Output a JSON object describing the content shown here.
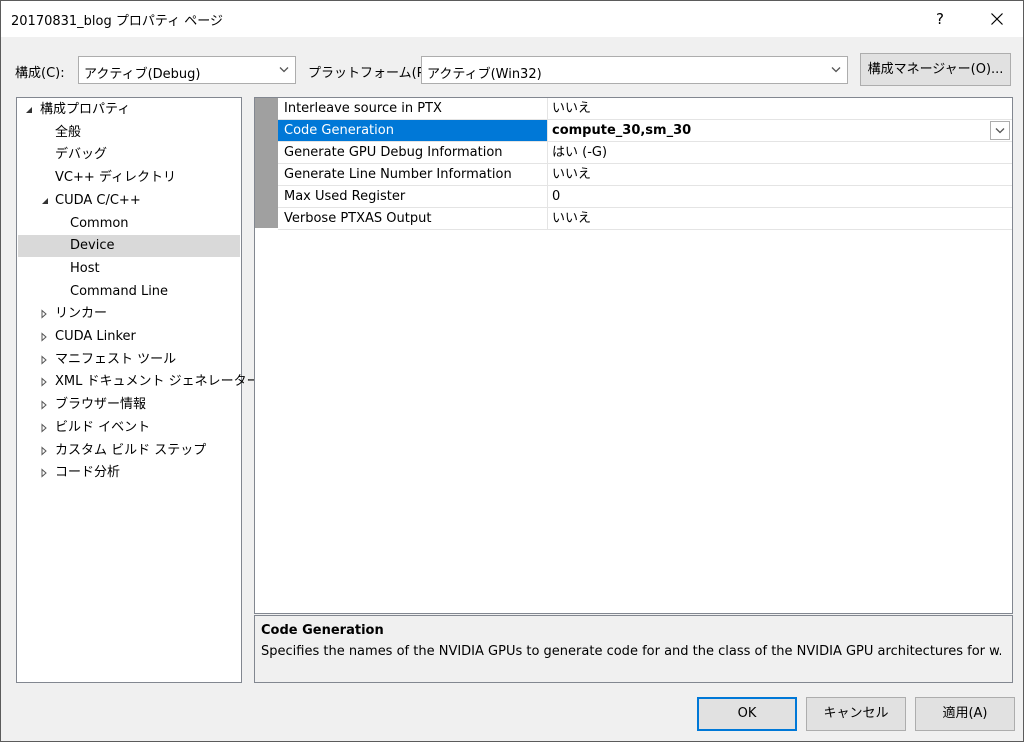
{
  "window": {
    "title": "20170831_blog プロパティ ページ",
    "help_label": "?"
  },
  "config": {
    "label": "構成(C):",
    "value": "アクティブ(Debug)"
  },
  "platform": {
    "label": "プラットフォーム(P):",
    "value": "アクティブ(Win32)"
  },
  "config_manager_label": "構成マネージャー(O)...",
  "tree": [
    {
      "label": "構成プロパティ",
      "expander": "expanded"
    },
    {
      "label": "全般",
      "expander": "none"
    },
    {
      "label": "デバッグ",
      "expander": "none"
    },
    {
      "label": "VC++ ディレクトリ",
      "expander": "none"
    },
    {
      "label": "CUDA C/C++",
      "expander": "expanded"
    },
    {
      "label": "Common",
      "expander": "none"
    },
    {
      "label": "Device",
      "expander": "none",
      "selected": true
    },
    {
      "label": "Host",
      "expander": "none"
    },
    {
      "label": "Command Line",
      "expander": "none"
    },
    {
      "label": "リンカー",
      "expander": "collapsed"
    },
    {
      "label": "CUDA Linker",
      "expander": "collapsed"
    },
    {
      "label": "マニフェスト ツール",
      "expander": "collapsed"
    },
    {
      "label": "XML ドキュメント ジェネレーター",
      "expander": "collapsed"
    },
    {
      "label": "ブラウザー情報",
      "expander": "collapsed"
    },
    {
      "label": "ビルド イベント",
      "expander": "collapsed"
    },
    {
      "label": "カスタム ビルド ステップ",
      "expander": "collapsed"
    },
    {
      "label": "コード分析",
      "expander": "collapsed"
    }
  ],
  "properties": [
    {
      "name": "Interleave source in PTX",
      "value": "いいえ"
    },
    {
      "name": "Code Generation",
      "value": "compute_30,sm_30",
      "selected": true
    },
    {
      "name": "Generate GPU Debug Information",
      "value": "はい (-G)"
    },
    {
      "name": "Generate Line Number Information",
      "value": "いいえ"
    },
    {
      "name": "Max Used Register",
      "value": "0"
    },
    {
      "name": "Verbose PTXAS Output",
      "value": "いいえ"
    }
  ],
  "description": {
    "title": "Code Generation",
    "text": "Specifies the names of the NVIDIA GPUs to generate code for and the class of the NVIDIA GPU architectures for w..."
  },
  "buttons": {
    "ok": "OK",
    "cancel": "キャンセル",
    "apply": "適用(A)"
  },
  "colors": {
    "selection": "#0078d7",
    "tree_selection": "#d9d9d9",
    "gutter": "#a0a0a0"
  }
}
